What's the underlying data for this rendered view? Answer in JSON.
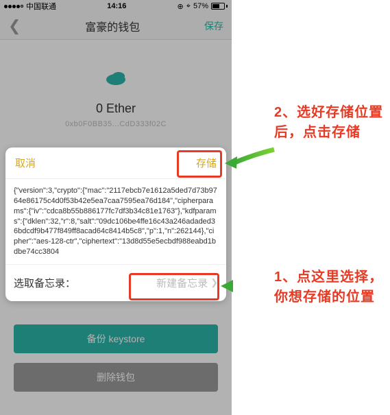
{
  "status": {
    "carrier": "中国联通",
    "time": "14:16",
    "battery_pct": "57%"
  },
  "nav": {
    "title": "富豪的钱包",
    "save": "保存"
  },
  "wallet": {
    "balance": "0 Ether",
    "address": "0xb0F0BB35...CdD333f02C"
  },
  "buttons": {
    "backup": "备份 keystore",
    "delete": "删除钱包"
  },
  "modal": {
    "cancel": "取消",
    "store": "存储",
    "json_text": "{\"version\":3,\"crypto\":{\"mac\":\"2117ebcb7e1612a5ded7d73b9764e86175c4d0f53b42e5ea7caa7595ea76d184\",\"cipherparams\":{\"iv\":\"cdca8b55b886177fc7df3b34c81e1763\"},\"kdfparams\":{\"dklen\":32,\"r\":8,\"salt\":\"09dc106be4ffe16c43a246adaded36bdcdf9b477f849ff8acad64c8414b5c8\",\"p\":1,\"n\":262144},\"cipher\":\"aes-128-ctr\",\"ciphertext\":\"13d8d55e5ecbdf988eabd1bdbe74cc3804",
    "foot_label": "选取备忘录：",
    "foot_action": "新建备忘录"
  },
  "annotations": {
    "a1": "2、选好存储位置后，点击存储",
    "a2": "1、点这里选择，你想存储的位置"
  }
}
